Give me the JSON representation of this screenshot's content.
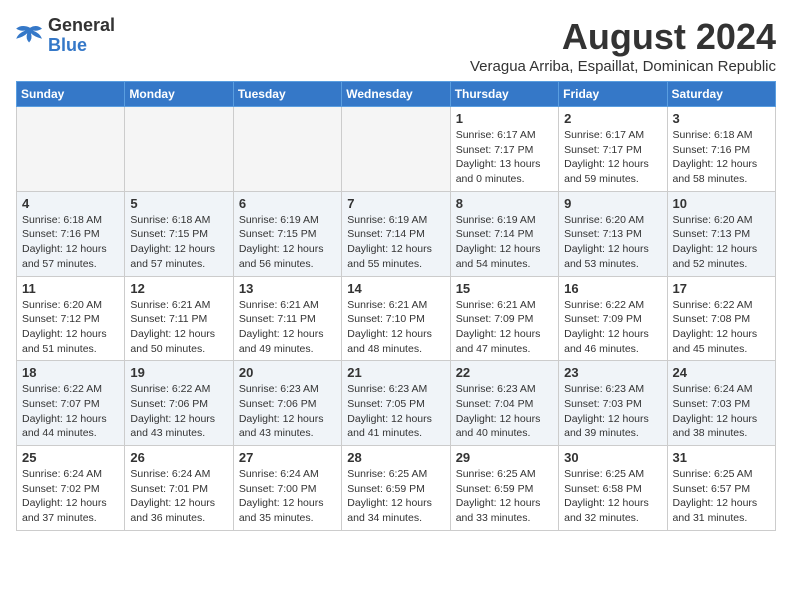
{
  "logo": {
    "line1": "General",
    "line2": "Blue"
  },
  "title": "August 2024",
  "subtitle": "Veragua Arriba, Espaillat, Dominican Republic",
  "weekdays": [
    "Sunday",
    "Monday",
    "Tuesday",
    "Wednesday",
    "Thursday",
    "Friday",
    "Saturday"
  ],
  "weeks": [
    [
      {
        "day": "",
        "info": ""
      },
      {
        "day": "",
        "info": ""
      },
      {
        "day": "",
        "info": ""
      },
      {
        "day": "",
        "info": ""
      },
      {
        "day": "1",
        "info": "Sunrise: 6:17 AM\nSunset: 7:17 PM\nDaylight: 13 hours\nand 0 minutes."
      },
      {
        "day": "2",
        "info": "Sunrise: 6:17 AM\nSunset: 7:17 PM\nDaylight: 12 hours\nand 59 minutes."
      },
      {
        "day": "3",
        "info": "Sunrise: 6:18 AM\nSunset: 7:16 PM\nDaylight: 12 hours\nand 58 minutes."
      }
    ],
    [
      {
        "day": "4",
        "info": "Sunrise: 6:18 AM\nSunset: 7:16 PM\nDaylight: 12 hours\nand 57 minutes."
      },
      {
        "day": "5",
        "info": "Sunrise: 6:18 AM\nSunset: 7:15 PM\nDaylight: 12 hours\nand 57 minutes."
      },
      {
        "day": "6",
        "info": "Sunrise: 6:19 AM\nSunset: 7:15 PM\nDaylight: 12 hours\nand 56 minutes."
      },
      {
        "day": "7",
        "info": "Sunrise: 6:19 AM\nSunset: 7:14 PM\nDaylight: 12 hours\nand 55 minutes."
      },
      {
        "day": "8",
        "info": "Sunrise: 6:19 AM\nSunset: 7:14 PM\nDaylight: 12 hours\nand 54 minutes."
      },
      {
        "day": "9",
        "info": "Sunrise: 6:20 AM\nSunset: 7:13 PM\nDaylight: 12 hours\nand 53 minutes."
      },
      {
        "day": "10",
        "info": "Sunrise: 6:20 AM\nSunset: 7:13 PM\nDaylight: 12 hours\nand 52 minutes."
      }
    ],
    [
      {
        "day": "11",
        "info": "Sunrise: 6:20 AM\nSunset: 7:12 PM\nDaylight: 12 hours\nand 51 minutes."
      },
      {
        "day": "12",
        "info": "Sunrise: 6:21 AM\nSunset: 7:11 PM\nDaylight: 12 hours\nand 50 minutes."
      },
      {
        "day": "13",
        "info": "Sunrise: 6:21 AM\nSunset: 7:11 PM\nDaylight: 12 hours\nand 49 minutes."
      },
      {
        "day": "14",
        "info": "Sunrise: 6:21 AM\nSunset: 7:10 PM\nDaylight: 12 hours\nand 48 minutes."
      },
      {
        "day": "15",
        "info": "Sunrise: 6:21 AM\nSunset: 7:09 PM\nDaylight: 12 hours\nand 47 minutes."
      },
      {
        "day": "16",
        "info": "Sunrise: 6:22 AM\nSunset: 7:09 PM\nDaylight: 12 hours\nand 46 minutes."
      },
      {
        "day": "17",
        "info": "Sunrise: 6:22 AM\nSunset: 7:08 PM\nDaylight: 12 hours\nand 45 minutes."
      }
    ],
    [
      {
        "day": "18",
        "info": "Sunrise: 6:22 AM\nSunset: 7:07 PM\nDaylight: 12 hours\nand 44 minutes."
      },
      {
        "day": "19",
        "info": "Sunrise: 6:22 AM\nSunset: 7:06 PM\nDaylight: 12 hours\nand 43 minutes."
      },
      {
        "day": "20",
        "info": "Sunrise: 6:23 AM\nSunset: 7:06 PM\nDaylight: 12 hours\nand 43 minutes."
      },
      {
        "day": "21",
        "info": "Sunrise: 6:23 AM\nSunset: 7:05 PM\nDaylight: 12 hours\nand 41 minutes."
      },
      {
        "day": "22",
        "info": "Sunrise: 6:23 AM\nSunset: 7:04 PM\nDaylight: 12 hours\nand 40 minutes."
      },
      {
        "day": "23",
        "info": "Sunrise: 6:23 AM\nSunset: 7:03 PM\nDaylight: 12 hours\nand 39 minutes."
      },
      {
        "day": "24",
        "info": "Sunrise: 6:24 AM\nSunset: 7:03 PM\nDaylight: 12 hours\nand 38 minutes."
      }
    ],
    [
      {
        "day": "25",
        "info": "Sunrise: 6:24 AM\nSunset: 7:02 PM\nDaylight: 12 hours\nand 37 minutes."
      },
      {
        "day": "26",
        "info": "Sunrise: 6:24 AM\nSunset: 7:01 PM\nDaylight: 12 hours\nand 36 minutes."
      },
      {
        "day": "27",
        "info": "Sunrise: 6:24 AM\nSunset: 7:00 PM\nDaylight: 12 hours\nand 35 minutes."
      },
      {
        "day": "28",
        "info": "Sunrise: 6:25 AM\nSunset: 6:59 PM\nDaylight: 12 hours\nand 34 minutes."
      },
      {
        "day": "29",
        "info": "Sunrise: 6:25 AM\nSunset: 6:59 PM\nDaylight: 12 hours\nand 33 minutes."
      },
      {
        "day": "30",
        "info": "Sunrise: 6:25 AM\nSunset: 6:58 PM\nDaylight: 12 hours\nand 32 minutes."
      },
      {
        "day": "31",
        "info": "Sunrise: 6:25 AM\nSunset: 6:57 PM\nDaylight: 12 hours\nand 31 minutes."
      }
    ]
  ]
}
